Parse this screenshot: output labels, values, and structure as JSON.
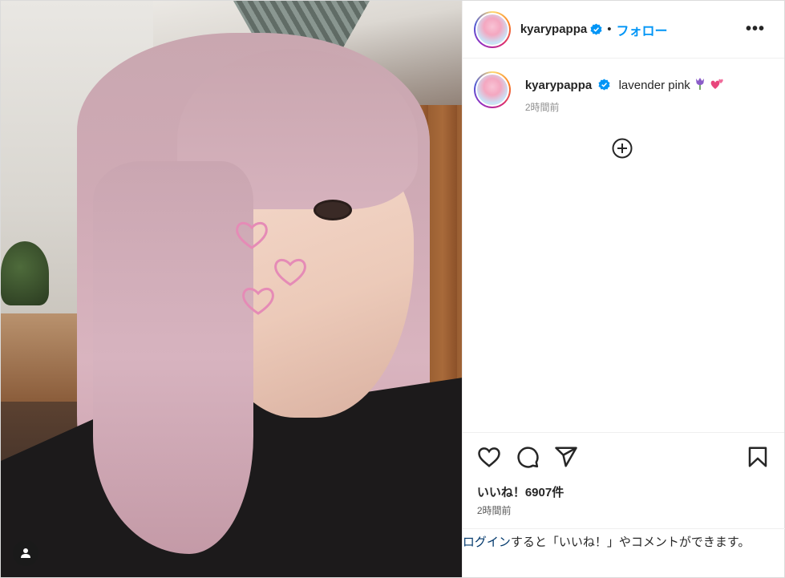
{
  "post": {
    "username": "kyarypappa",
    "follow_label": "フォロー",
    "more_label": "•••",
    "dot": "•",
    "caption_text": "lavender pink",
    "caption_emojis": [
      "tulip-emoji",
      "two-hearts-emoji"
    ],
    "caption_time": "2時間前",
    "likes_label": "いいね！6907件",
    "likes_count": 6907,
    "post_time": "2時間前"
  },
  "login_prompt": {
    "link": "ログイン",
    "text": "すると「いいね！」やコメントができます。"
  },
  "colors": {
    "follow_blue": "#0095f6",
    "verified_blue": "#0095f6",
    "heart_pink": "#e58bb6"
  },
  "icons": [
    "verified-badge-icon",
    "more-options-icon",
    "load-more-comments-icon",
    "like-heart-icon",
    "comment-icon",
    "share-icon",
    "save-bookmark-icon",
    "user-tag-icon"
  ]
}
